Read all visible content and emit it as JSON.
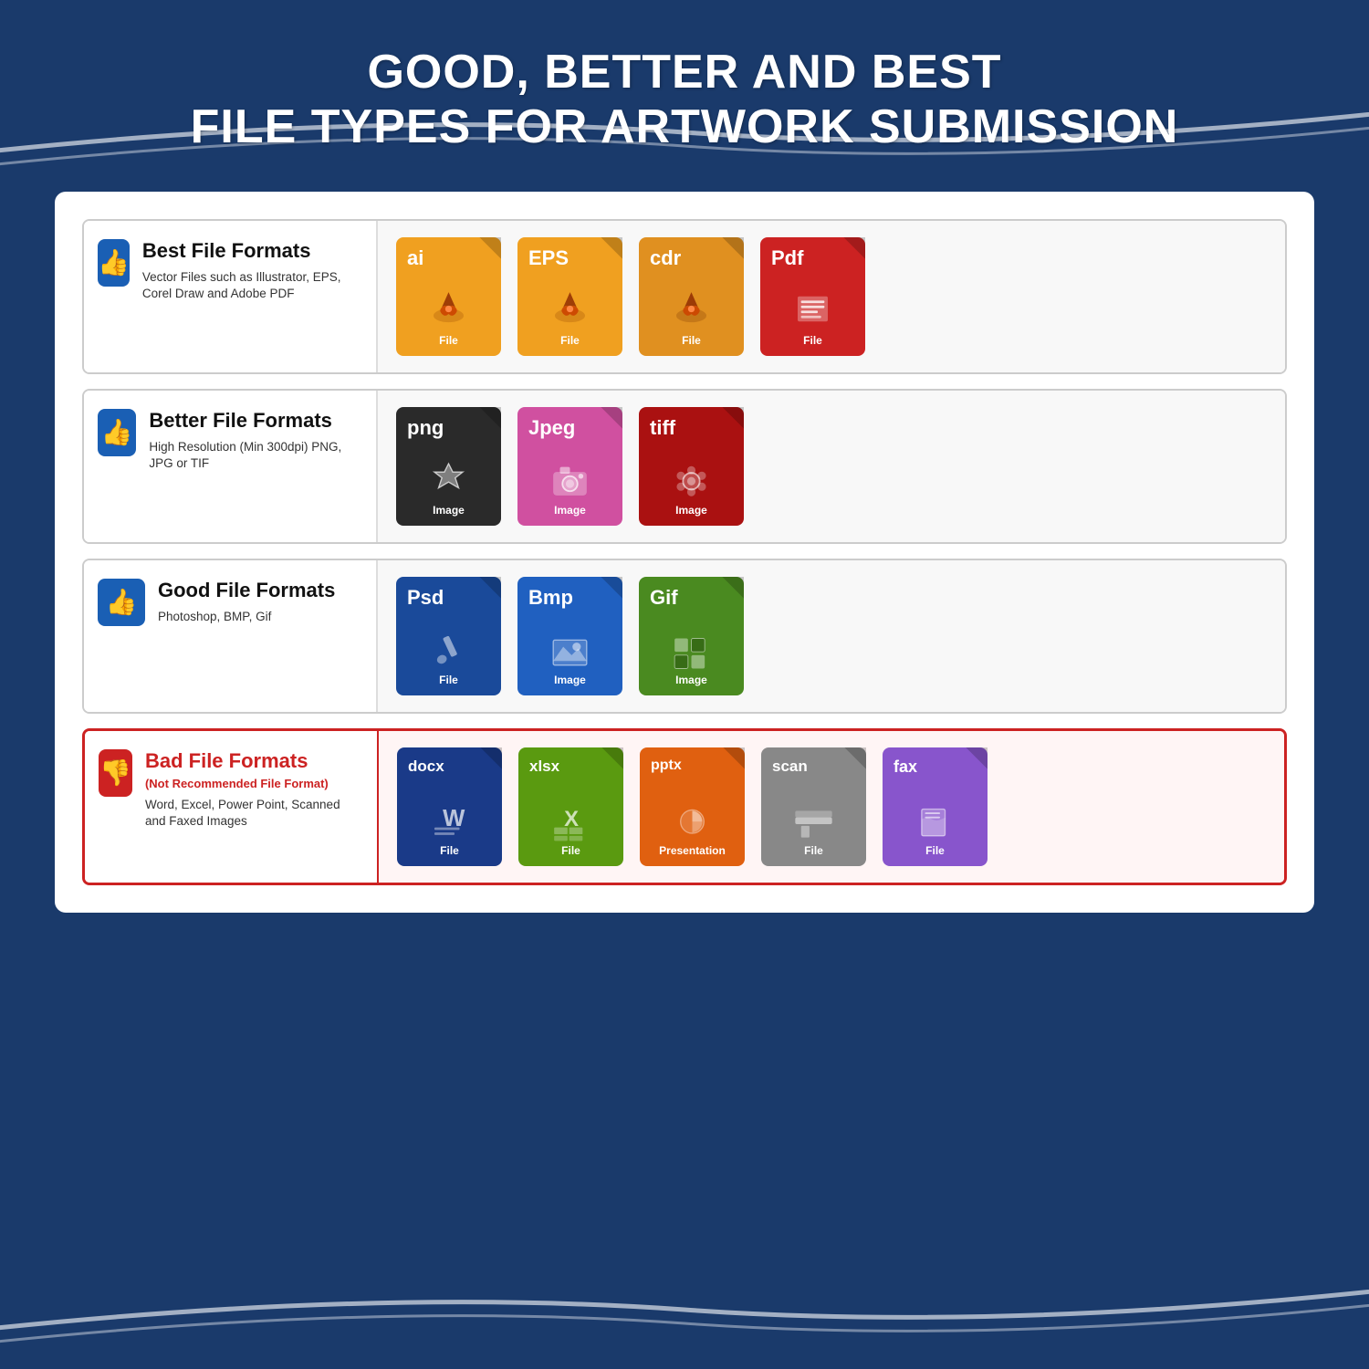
{
  "header": {
    "title_line1": "GOOD, BETTER AND BEST",
    "title_line2": "FILE TYPES FOR ARTWORK SUBMISSION"
  },
  "rows": [
    {
      "id": "best",
      "thumbType": "up",
      "title": "Best File Formats",
      "subtitle": null,
      "description": "Vector Files such as Illustrator, EPS, Corel Draw and Adobe PDF",
      "files": [
        {
          "ext": "ai",
          "label": "File",
          "color": "orange",
          "graphic": "pen"
        },
        {
          "ext": "EPS",
          "label": "File",
          "color": "orange",
          "graphic": "pen"
        },
        {
          "ext": "cdr",
          "label": "File",
          "color": "orange-dark",
          "graphic": "pen"
        },
        {
          "ext": "Pdf",
          "label": "File",
          "color": "red",
          "graphic": "document"
        }
      ]
    },
    {
      "id": "better",
      "thumbType": "up",
      "title": "Better File Formats",
      "subtitle": null,
      "description": "High Resolution (Min 300dpi) PNG, JPG or TIF",
      "files": [
        {
          "ext": "png",
          "label": "Image",
          "color": "black",
          "graphic": "star"
        },
        {
          "ext": "Jpeg",
          "label": "Image",
          "color": "pink",
          "graphic": "camera"
        },
        {
          "ext": "tiff",
          "label": "Image",
          "color": "darkred",
          "graphic": "flower"
        }
      ]
    },
    {
      "id": "good",
      "thumbType": "up",
      "title": "Good File Formats",
      "subtitle": null,
      "description": "Photoshop, BMP, Gif",
      "files": [
        {
          "ext": "Psd",
          "label": "File",
          "color": "navy",
          "graphic": "brush"
        },
        {
          "ext": "Bmp",
          "label": "Image",
          "color": "blue",
          "graphic": "image"
        },
        {
          "ext": "Gif",
          "label": "Image",
          "color": "green",
          "graphic": "grid"
        }
      ]
    },
    {
      "id": "bad",
      "thumbType": "down",
      "title": "Bad File Formats",
      "subtitle": "(Not Recommended File Format)",
      "description": "Word, Excel, Power Point, Scanned and Faxed Images",
      "files": [
        {
          "ext": "docx",
          "label": "File",
          "color": "darkblue",
          "graphic": "word"
        },
        {
          "ext": "xlsx",
          "label": "File",
          "color": "lime",
          "graphic": "excel"
        },
        {
          "ext": "pptx",
          "label": "Presentation",
          "color": "orange2",
          "graphic": "ppt"
        },
        {
          "ext": "scan",
          "label": "File",
          "color": "gray",
          "graphic": "scanner"
        },
        {
          "ext": "fax",
          "label": "File",
          "color": "purple",
          "graphic": "fax"
        }
      ]
    }
  ]
}
